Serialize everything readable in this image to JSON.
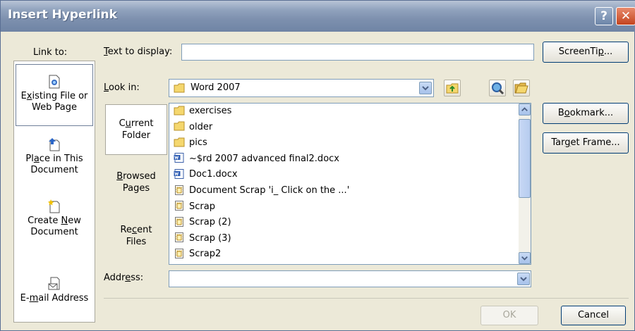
{
  "dialog": {
    "title": "Insert Hyperlink",
    "help_glyph": "?",
    "close_glyph": "✕"
  },
  "link_to": {
    "label": "Link to:",
    "items": [
      {
        "pre": "E",
        "u": "x",
        "post": "isting File or Web Page",
        "icon": "existing-file-icon"
      },
      {
        "pre": "Pl",
        "u": "a",
        "post": "ce in This Document",
        "icon": "place-in-document-icon"
      },
      {
        "pre": "Create ",
        "u": "N",
        "post": "ew Document",
        "icon": "create-new-document-icon"
      },
      {
        "pre": "E-",
        "u": "m",
        "post": "ail Address",
        "icon": "email-address-icon"
      }
    ]
  },
  "text_to_display": {
    "pre": "",
    "u": "T",
    "post": "ext to display:",
    "value": ""
  },
  "screentip": {
    "pre": "ScreenTi",
    "u": "p",
    "post": "..."
  },
  "look_in": {
    "pre": "",
    "u": "L",
    "post": "ook in:",
    "value": "Word 2007"
  },
  "nav": [
    {
      "pre": "C",
      "u": "u",
      "post": "rrent Folder"
    },
    {
      "pre": "",
      "u": "B",
      "post": "rowsed Pages"
    },
    {
      "pre": "Re",
      "u": "c",
      "post": "ent Files"
    }
  ],
  "files": [
    {
      "name": "exercises",
      "icon": "folder-icon"
    },
    {
      "name": "older",
      "icon": "folder-icon"
    },
    {
      "name": "pics",
      "icon": "folder-icon"
    },
    {
      "name": "~$rd 2007 advanced final2.docx",
      "icon": "word-doc-icon"
    },
    {
      "name": "Doc1.docx",
      "icon": "word-doc-icon"
    },
    {
      "name": "Document Scrap 'i_ Click on the ...'",
      "icon": "scrap-icon"
    },
    {
      "name": "Scrap",
      "icon": "scrap-icon"
    },
    {
      "name": "Scrap (2)",
      "icon": "scrap-icon"
    },
    {
      "name": "Scrap (3)",
      "icon": "scrap-icon"
    },
    {
      "name": "Scrap2",
      "icon": "scrap-icon"
    }
  ],
  "bookmark": {
    "pre": "B",
    "u": "o",
    "post": "okmark..."
  },
  "target_frame": {
    "pre": "Tar",
    "u": "g",
    "post": "et Frame..."
  },
  "address": {
    "pre": "Addr",
    "u": "e",
    "post": "ss:",
    "value": ""
  },
  "ok_label": "OK",
  "cancel_label": "Cancel",
  "colors": {
    "title_bar": "#7d90ae",
    "dialog_bg": "#ECE9D8",
    "field_border": "#7f9db9",
    "close_button": "#c4441e"
  }
}
